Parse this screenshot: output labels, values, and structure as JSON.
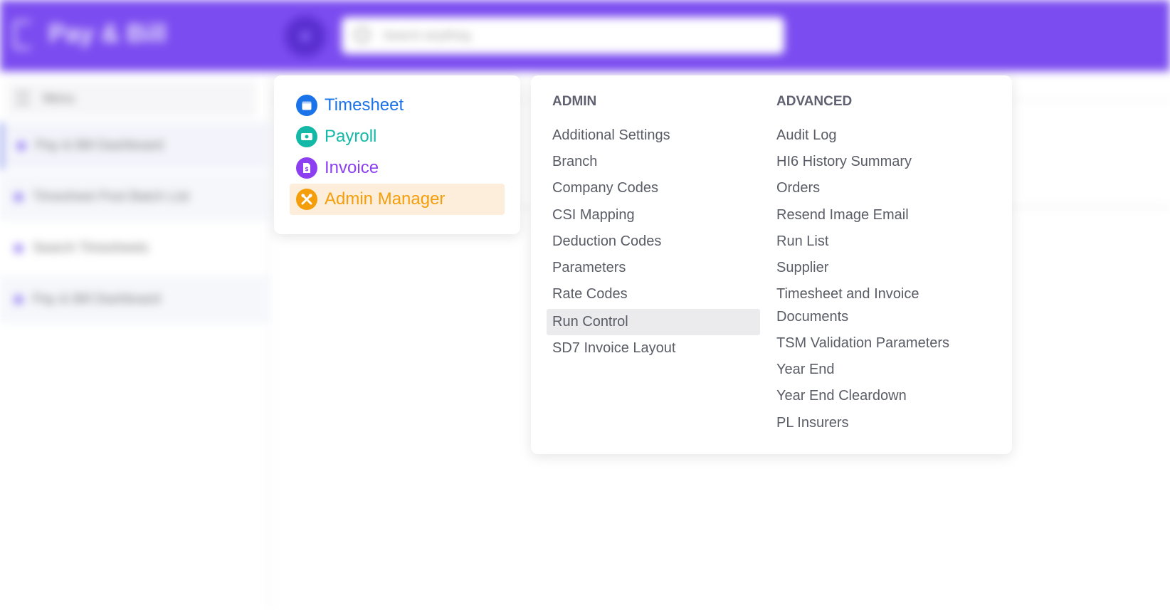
{
  "header": {
    "app_name": "Pay & Bill",
    "search_placeholder": "Search anything"
  },
  "sidebar": {
    "menu_label": "Menu",
    "items": [
      {
        "label": "Pay & Bill Dashboard"
      },
      {
        "label": "Timesheet Pool Batch List"
      },
      {
        "label": "Search Timesheets"
      },
      {
        "label": "Pay & Bill Dashboard"
      }
    ]
  },
  "modules": {
    "items": [
      {
        "label": "Timesheet",
        "color": "#1a73e8",
        "icon": "calendar-icon"
      },
      {
        "label": "Payroll",
        "color": "#14b8a6",
        "icon": "money-icon"
      },
      {
        "label": "Invoice",
        "color": "#8b3ff0",
        "icon": "invoice-icon"
      },
      {
        "label": "Admin Manager",
        "color": "#f59e0b",
        "icon": "tools-icon",
        "active": true
      }
    ]
  },
  "submenu": {
    "admin": {
      "heading": "ADMIN",
      "items": [
        "Additional Settings",
        "Branch",
        "Company Codes",
        "CSI Mapping",
        "Deduction Codes",
        "Parameters",
        "Rate Codes",
        "Run Control",
        "SD7 Invoice Layout"
      ],
      "highlighted": "Run Control"
    },
    "advanced": {
      "heading": "ADVANCED",
      "items": [
        "Audit Log",
        "HI6 History Summary",
        "Orders",
        "Resend Image Email",
        "Run List",
        "Supplier",
        "Timesheet and Invoice",
        "Documents",
        "TSM Validation Parameters",
        "Year End",
        "Year End Cleardown",
        "PL Insurers"
      ]
    }
  }
}
